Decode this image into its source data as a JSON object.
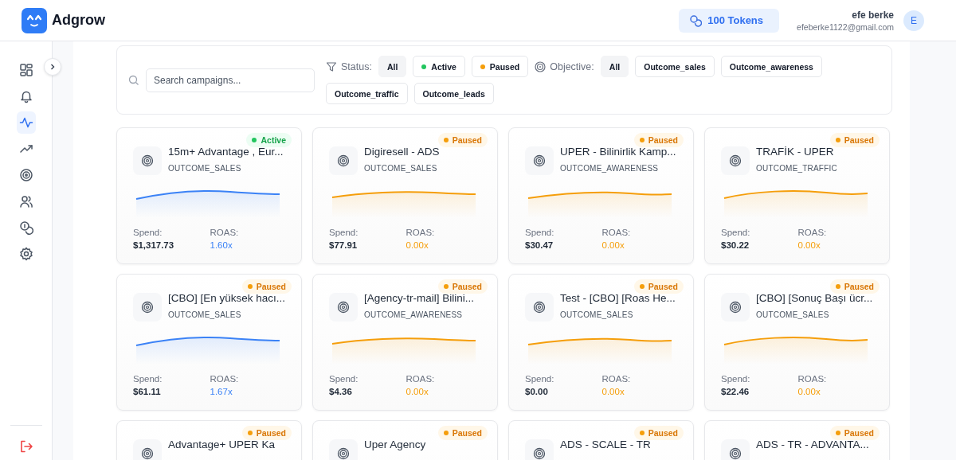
{
  "header": {
    "brand": "Adgrow",
    "tokens": "100 Tokens",
    "user_name": "efe berke",
    "user_email": "efeberke1122@gmail.com",
    "avatar_initial": "E"
  },
  "sidebar": {
    "items": [
      {
        "kind": "grid",
        "selected": false
      },
      {
        "kind": "bell",
        "selected": false
      },
      {
        "kind": "pulse",
        "selected": true
      },
      {
        "kind": "trend",
        "selected": false
      },
      {
        "kind": "target",
        "selected": false
      },
      {
        "kind": "users",
        "selected": false
      },
      {
        "kind": "coins",
        "selected": false
      },
      {
        "kind": "gear",
        "selected": false
      }
    ]
  },
  "filters": {
    "search_placeholder": "Search campaigns...",
    "status_label": "Status:",
    "status_options": [
      {
        "label": "All",
        "kind": "plain",
        "selected": true
      },
      {
        "label": "Active",
        "kind": "active",
        "selected": false
      },
      {
        "label": "Paused",
        "kind": "paused",
        "selected": false
      }
    ],
    "objective_label": "Objective:",
    "objective_options": [
      {
        "label": "All",
        "selected": true
      },
      {
        "label": "Outcome_sales",
        "selected": false
      },
      {
        "label": "Outcome_awareness",
        "selected": false
      },
      {
        "label": "Outcome_traffic",
        "selected": false
      },
      {
        "label": "Outcome_leads",
        "selected": false
      }
    ]
  },
  "campaigns": [
    {
      "title": "15m+ Advantage , Eur...",
      "status": {
        "label": "Active",
        "kind": "active"
      },
      "objective": "OUTCOME_SALES",
      "spend_label": "Spend:",
      "spend": "$1,317.73",
      "roas_label": "ROAS:",
      "roas": "1.60x",
      "color": "#3b82f6"
    },
    {
      "title": "Digiresell - ADS",
      "status": {
        "label": "Paused",
        "kind": "paused"
      },
      "objective": "OUTCOME_SALES",
      "spend_label": "Spend:",
      "spend": "$77.91",
      "roas_label": "ROAS:",
      "roas": "0.00x",
      "color": "#f59e0b"
    },
    {
      "title": "UPER - Bilinirlik Kamp...",
      "status": {
        "label": "Paused",
        "kind": "paused"
      },
      "objective": "OUTCOME_AWARENESS",
      "spend_label": "Spend:",
      "spend": "$30.47",
      "roas_label": "ROAS:",
      "roas": "0.00x",
      "color": "#f59e0b"
    },
    {
      "title": "TRAFİK - UPER",
      "status": {
        "label": "Paused",
        "kind": "paused"
      },
      "objective": "OUTCOME_TRAFFIC",
      "spend_label": "Spend:",
      "spend": "$30.22",
      "roas_label": "ROAS:",
      "roas": "0.00x",
      "color": "#f59e0b"
    },
    {
      "title": "[CBO] [En yüksek hacı...",
      "status": {
        "label": "Paused",
        "kind": "paused"
      },
      "objective": "OUTCOME_SALES",
      "spend_label": "Spend:",
      "spend": "$61.11",
      "roas_label": "ROAS:",
      "roas": "1.67x",
      "color": "#3b82f6"
    },
    {
      "title": "[Agency-tr-mail] Bilini...",
      "status": {
        "label": "Paused",
        "kind": "paused"
      },
      "objective": "OUTCOME_AWARENESS",
      "spend_label": "Spend:",
      "spend": "$4.36",
      "roas_label": "ROAS:",
      "roas": "0.00x",
      "color": "#f59e0b"
    },
    {
      "title": "Test - [CBO] [Roas He...",
      "status": {
        "label": "Paused",
        "kind": "paused"
      },
      "objective": "OUTCOME_SALES",
      "spend_label": "Spend:",
      "spend": "$0.00",
      "roas_label": "ROAS:",
      "roas": "0.00x",
      "color": "#f59e0b"
    },
    {
      "title": "[CBO] [Sonuç Başı ücr...",
      "status": {
        "label": "Paused",
        "kind": "paused"
      },
      "objective": "OUTCOME_SALES",
      "spend_label": "Spend:",
      "spend": "$22.46",
      "roas_label": "ROAS:",
      "roas": "0.00x",
      "color": "#f59e0b"
    },
    {
      "title": "Advantage+ UPER Ka",
      "status": {
        "label": "Paused",
        "kind": "paused"
      }
    },
    {
      "title": "Uper Agency",
      "status": {
        "label": "Paused",
        "kind": "paused"
      }
    },
    {
      "title": "ADS - SCALE - TR",
      "status": {
        "label": "Paused",
        "kind": "paused"
      }
    },
    {
      "title": "ADS - TR - ADVANTA...",
      "status": {
        "label": "Paused",
        "kind": "paused"
      }
    }
  ]
}
